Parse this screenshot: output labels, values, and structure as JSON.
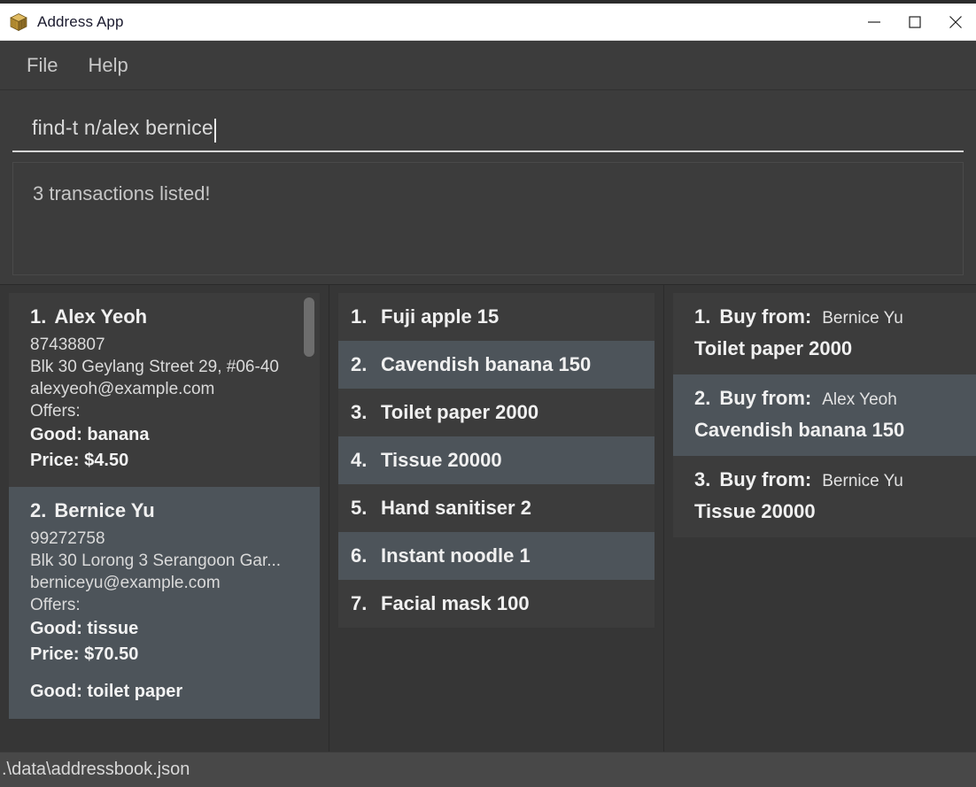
{
  "window": {
    "title": "Address App",
    "icon": "box-icon",
    "controls": {
      "minimize": "minimize-icon",
      "maximize": "maximize-icon",
      "close": "close-icon"
    }
  },
  "menubar": {
    "items": [
      {
        "label": "File"
      },
      {
        "label": "Help"
      }
    ]
  },
  "command": {
    "value": "find-t n/alex bernice",
    "placeholder": "Enter command here..."
  },
  "result": {
    "text": "3 transactions listed!"
  },
  "persons": {
    "panel_name": "person-list-panel",
    "items": [
      {
        "index": "1.",
        "name": "Alex Yeoh",
        "phone": "87438807",
        "address": "Blk 30 Geylang Street 29, #06-40",
        "email": "alexyeoh@example.com",
        "offers_label": "Offers:",
        "offers": [
          {
            "good": "Good: banana",
            "price": "Price: $4.50"
          }
        ],
        "selected": false
      },
      {
        "index": "2.",
        "name": "Bernice Yu",
        "phone": "99272758",
        "address": "Blk 30 Lorong 3 Serangoon Gar...",
        "email": "berniceyu@example.com",
        "offers_label": "Offers:",
        "offers": [
          {
            "good": "Good: tissue",
            "price": "Price: $70.50"
          },
          {
            "good": "Good: toilet paper",
            "price": ""
          }
        ],
        "selected": true
      }
    ],
    "scrollbar": {
      "visible": true,
      "thumb_position_percent": 1,
      "thumb_size_percent": 13
    }
  },
  "goods": {
    "panel_name": "goods-list-panel",
    "items": [
      {
        "index": "1.",
        "label": "Fuji apple 15"
      },
      {
        "index": "2.",
        "label": "Cavendish banana 150"
      },
      {
        "index": "3.",
        "label": "Toilet paper 2000"
      },
      {
        "index": "4.",
        "label": "Tissue 20000"
      },
      {
        "index": "5.",
        "label": "Hand sanitiser 2"
      },
      {
        "index": "6.",
        "label": "Instant noodle 1"
      },
      {
        "index": "7.",
        "label": "Facial mask 100"
      }
    ]
  },
  "transactions": {
    "panel_name": "transaction-list-panel",
    "buy_from_label": "Buy from:",
    "items": [
      {
        "index": "1.",
        "label": "Buy from:",
        "person": "Bernice Yu",
        "good": "Toilet paper 2000"
      },
      {
        "index": "2.",
        "label": "Buy from:",
        "person": "Alex Yeoh",
        "good": "Cavendish banana 150"
      },
      {
        "index": "3.",
        "label": "Buy from:",
        "person": "Bernice Yu",
        "good": "Tissue 20000"
      }
    ]
  },
  "statusbar": {
    "path": ".\\data\\addressbook.json"
  },
  "colors": {
    "window_bg": "#323232",
    "panel_bg": "#363636",
    "card_bg": "#3c3c3c",
    "card_selected_bg": "#4d545a",
    "titlebar_bg": "#ffffff",
    "titlebar_text": "#1a1a2e",
    "menubar_bg": "#3c3c3c",
    "menu_text": "#c8c8c8",
    "text_primary": "#f0f0f0",
    "text_secondary": "#dadada",
    "statusbar_bg": "#484848",
    "accent_icon": "#c8992e"
  }
}
